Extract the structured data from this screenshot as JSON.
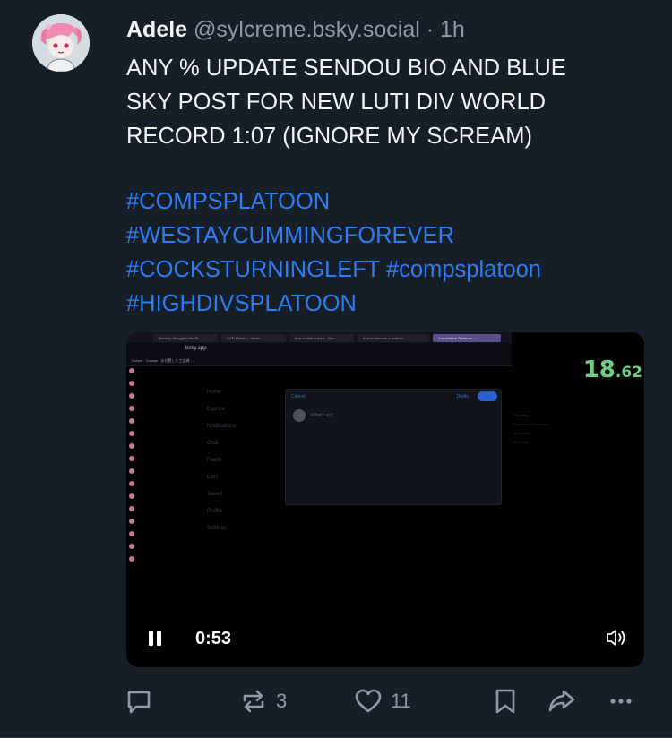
{
  "post": {
    "author_name": "Adele",
    "author_handle": "@sylcreme.bsky.social",
    "separator": "·",
    "time": "1h",
    "text_lines": [
      "ANY % UPDATE SENDOU BIO AND BLUE",
      "SKY POST FOR NEW LUTI DIV WORLD",
      "RECORD 1:07 (IGNORE MY SCREAM)"
    ],
    "hashtags": [
      "#COMPSPLATOON",
      "#WESTAYCUMMINGFOREVER",
      "#COCKSTURNINGLEFT",
      "#compsplatoon",
      "#HIGHDIVSPLATOON"
    ]
  },
  "video": {
    "browser_tabs": [
      "Mommy Snuggles Her Sl...",
      "LUTI Direct — divisio...",
      "how to hide a body - Sea...",
      "how to become a dodech...",
      "Competitive Splatoon — ..."
    ],
    "url": "bsky.app",
    "bookmarks": [
      "School",
      "Canvas",
      "お仕置した工女様 ..."
    ],
    "left_nav": [
      "Home",
      "Explore",
      "Notifications",
      "Chat",
      "Feeds",
      "Lists",
      "Saved",
      "Profile",
      "Settings"
    ],
    "compose_cancel": "Cancel",
    "compose_drafts": "Drafts",
    "compose_placeholder": "What's up?",
    "right_panel": [
      "Following",
      "Competitive Splatoon",
      "More feeds",
      "Trending"
    ],
    "timer_main": "18",
    "timer_fraction": ".62",
    "time": "0:53"
  },
  "actions": {
    "repost_count": "3",
    "like_count": "11"
  },
  "colors": {
    "background": "#161e27",
    "hashtag": "#2f7bf0",
    "muted": "#8d9aa8",
    "timer": "#6ecf84"
  },
  "icons": [
    "reply-icon",
    "repost-icon",
    "like-icon",
    "bookmark-icon",
    "share-icon",
    "more-icon",
    "pause-icon",
    "volume-icon"
  ]
}
